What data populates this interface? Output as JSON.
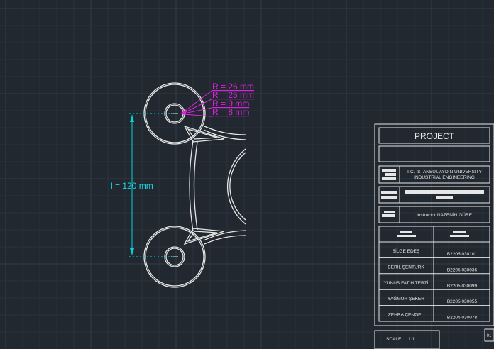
{
  "drawing": {
    "radii_labels": [
      "R = 26 mm",
      "R = 25 mm",
      "R = 9 mm",
      "R = 8 mm"
    ],
    "length_label": "l = 120 mm"
  },
  "title_block": {
    "project_label": "PROJECT",
    "university_line1": "T.C. ISTANBUL AYDIN UNIVERSITY",
    "university_line2": "INDUSTRIAL ENGINEERING",
    "instructor": "Instructor NAZENİN GÜRE",
    "students": [
      {
        "name": "BİLGE EDEŞ",
        "id": "B2205.030101"
      },
      {
        "name": "BERİL ŞENTÜRK",
        "id": "B2205.030036"
      },
      {
        "name": "YUNUS FATİH TERZİ",
        "id": "B2205.030099"
      },
      {
        "name": "YAĞMUR ŞEKER",
        "id": "B2205.030055"
      },
      {
        "name": "ZEHRA ÇENGEL",
        "id": "B2205.030078"
      }
    ],
    "scale_label": "SCALE:",
    "scale_value": "1:1",
    "sheet_number": "01"
  }
}
